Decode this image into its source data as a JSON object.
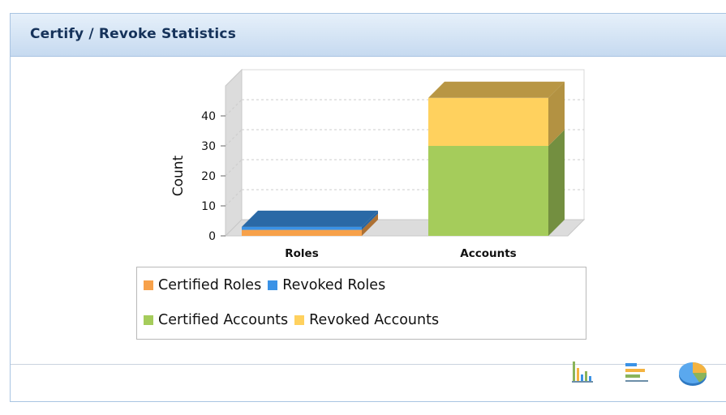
{
  "panel": {
    "title": "Certify / Revoke Statistics"
  },
  "colors": {
    "certified_roles": "#f7a14a",
    "revoked_roles": "#3a92e6",
    "certified_accounts": "#a5cc5b",
    "revoked_accounts": "#ffd15e"
  },
  "chart_data": {
    "type": "bar",
    "stacked": true,
    "three_d": true,
    "categories": [
      "Roles",
      "Accounts"
    ],
    "series": [
      {
        "name": "Certified Roles",
        "values": [
          2,
          0
        ]
      },
      {
        "name": "Revoked Roles",
        "values": [
          1,
          0
        ]
      },
      {
        "name": "Certified Accounts",
        "values": [
          0,
          30
        ]
      },
      {
        "name": "Revoked Accounts",
        "values": [
          0,
          16
        ]
      }
    ],
    "ylabel": "Count",
    "yticks": [
      0,
      10,
      20,
      30,
      40
    ],
    "ylim": [
      0,
      50
    ],
    "grid": true,
    "legend_placement": "bottom"
  },
  "footer": {
    "buttons": [
      "vertical-bar-chart-icon",
      "horizontal-bar-chart-icon",
      "pie-chart-icon"
    ]
  }
}
